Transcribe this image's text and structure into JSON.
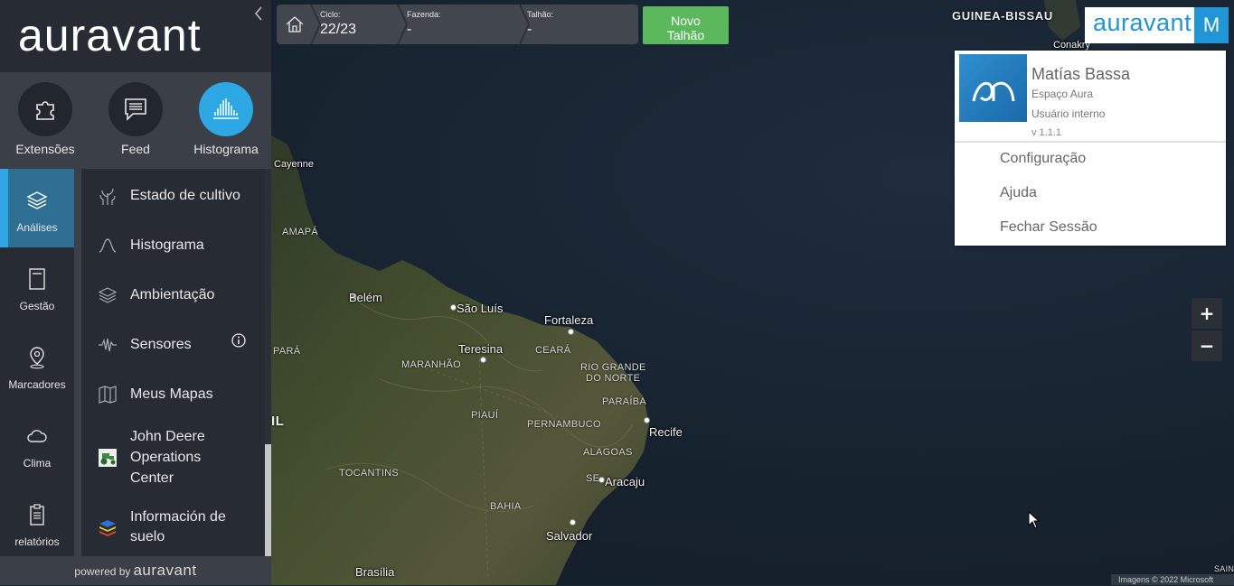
{
  "app": {
    "brand": "auravant",
    "powered_prefix": "powered by",
    "powered_brand": "auravant"
  },
  "shortcuts": [
    {
      "label": "Extensões",
      "icon": "puzzle-icon"
    },
    {
      "label": "Feed",
      "icon": "chat-icon"
    },
    {
      "label": "Histograma",
      "icon": "histogram-icon",
      "active": true
    }
  ],
  "rail": [
    {
      "label": "Análises",
      "icon": "layers-icon",
      "active": true
    },
    {
      "label": "Gestão",
      "icon": "notebook-icon"
    },
    {
      "label": "Marcadores",
      "icon": "map-pin-icon"
    },
    {
      "label": "Clima",
      "icon": "cloud-icon"
    },
    {
      "label": "relatórios",
      "icon": "clipboard-icon"
    }
  ],
  "menu": [
    {
      "label": "Estado de cultivo",
      "icon": "plant-icon"
    },
    {
      "label": "Histograma",
      "icon": "curve-icon"
    },
    {
      "label": "Ambientação",
      "icon": "layers-icon"
    },
    {
      "label": "Sensores",
      "icon": "wave-icon",
      "info": true
    },
    {
      "label": "Meus Mapas",
      "icon": "folded-map-icon"
    },
    {
      "label": "John Deere Operations Center",
      "label_lines": [
        "John Deere",
        "Operations",
        "Center"
      ],
      "icon": "tractor-icon"
    },
    {
      "label": "Información de suelo",
      "label_lines": [
        "Información de",
        "suelo"
      ],
      "icon": "soil-layers-icon"
    }
  ],
  "topbar": {
    "cycle_label": "Ciclo:",
    "cycle_value": "22/23",
    "farm_label": "Fazenda:",
    "farm_value": "-",
    "plot_label": "Talhão:",
    "plot_value": "-",
    "new_plot_label": "Novo Talhão",
    "new_plot_lines": [
      "Novo",
      "Talhão"
    ]
  },
  "user": {
    "avatar_letter": "M",
    "logo_word": "auravant",
    "name": "Matías Bassa",
    "space": "Espaço Aura",
    "role": "Usuário interno",
    "version": "v 1.1.1",
    "links": [
      "Configuração",
      "Ajuda",
      "Fechar Sessão"
    ]
  },
  "zoom": {
    "in": "+",
    "out": "−"
  },
  "map": {
    "countries": [
      "GUINEA-BISSAU",
      "IL"
    ],
    "cities": [
      "Cayenne",
      "Belém",
      "São Luís",
      "Fortaleza",
      "Teresina",
      "Recife",
      "Aracaju",
      "Salvador",
      "Brasília",
      "Conakry"
    ],
    "states": [
      "AMAPÁ",
      "PARÁ",
      "MARANHÃO",
      "CEARÁ",
      "RIO GRANDE",
      "DO NORTE",
      "PARAÍBA",
      "PIAUÍ",
      "PERNAMBUCO",
      "ALAGOAS",
      "SE",
      "TOCANTINS",
      "BAHIA",
      "SAIN"
    ],
    "attribution": "Imagens © 2022 Microsoft"
  },
  "colors": {
    "accent": "#2ea7e5",
    "green": "#5cb85c",
    "sidebar": "#262b34",
    "brand_blue": "#2196d6"
  }
}
